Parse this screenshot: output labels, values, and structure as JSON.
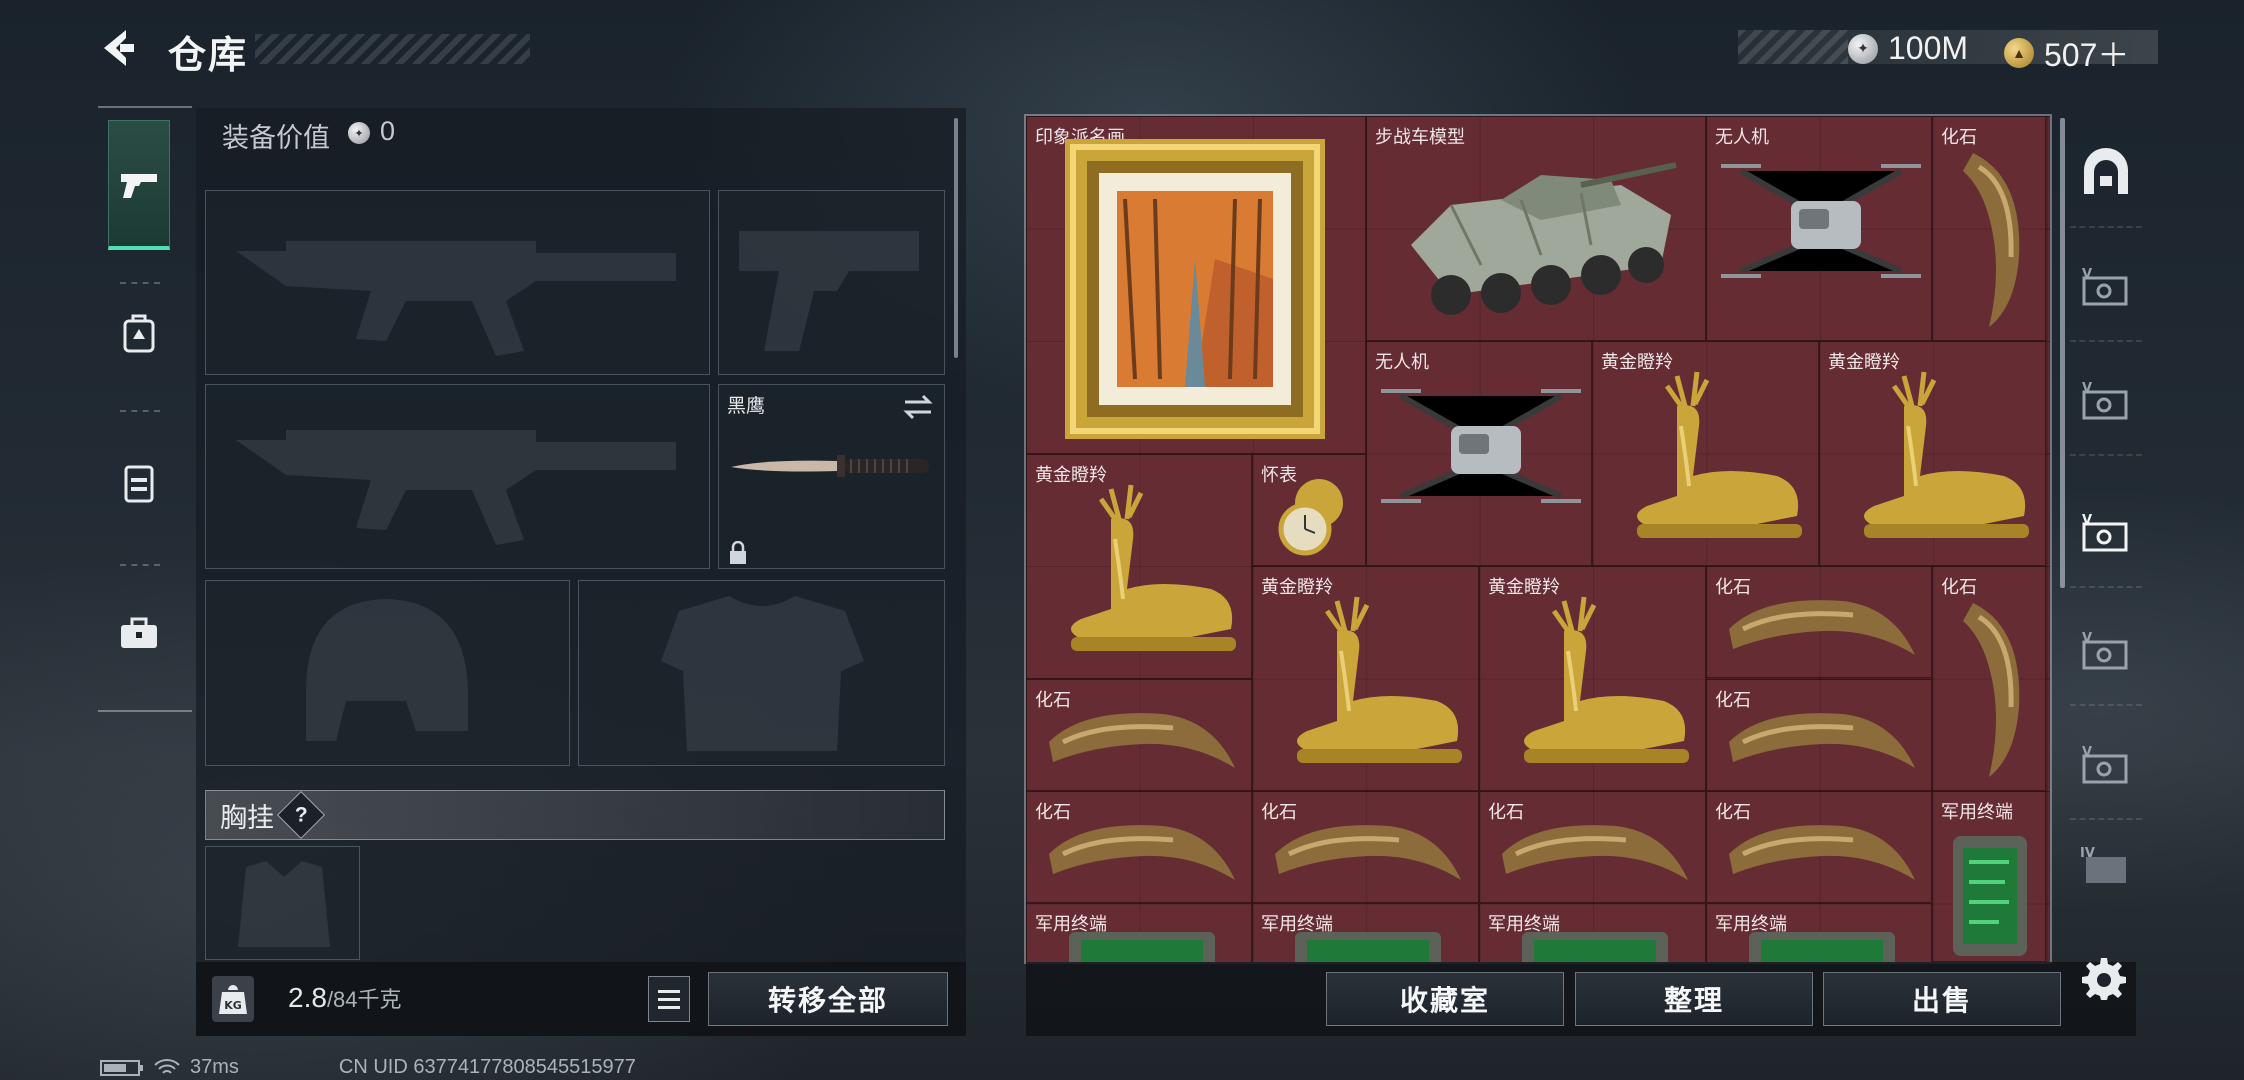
{
  "header": {
    "title": "仓库"
  },
  "currency": [
    {
      "icon": "silver-coin-icon",
      "value": "100M"
    },
    {
      "icon": "gold-coin-icon",
      "value": "507＋"
    }
  ],
  "equipment": {
    "value_label": "装备价值",
    "value": "0",
    "melee_name": "黑鹰",
    "chest_label": "胸挂",
    "help": "?"
  },
  "capacity": {
    "current": "2.8",
    "max": "/84千克"
  },
  "buttons": {
    "transfer_all": "转移全部",
    "collection": "收藏室",
    "organize": "整理",
    "sell": "出售"
  },
  "warehouse_items": [
    {
      "name": "印象派名画",
      "icon": "painting-icon"
    },
    {
      "name": "步战车模型",
      "icon": "ifv-model-icon"
    },
    {
      "name": "无人机",
      "icon": "drone-icon"
    },
    {
      "name": "化石",
      "icon": "fossil-claw-icon"
    },
    {
      "name": "无人机",
      "icon": "drone-icon"
    },
    {
      "name": "黄金瞪羚",
      "icon": "golden-gazelle-icon"
    },
    {
      "name": "黄金瞪羚",
      "icon": "golden-gazelle-icon"
    },
    {
      "name": "黄金瞪羚",
      "icon": "golden-gazelle-icon"
    },
    {
      "name": "怀表",
      "icon": "pocket-watch-icon"
    },
    {
      "name": "黄金瞪羚",
      "icon": "golden-gazelle-icon"
    },
    {
      "name": "黄金瞪羚",
      "icon": "golden-gazelle-icon"
    },
    {
      "name": "化石",
      "icon": "fossil-claw-icon"
    },
    {
      "name": "化石",
      "icon": "fossil-claw-icon"
    },
    {
      "name": "化石",
      "icon": "fossil-claw-icon"
    },
    {
      "name": "化石",
      "icon": "fossil-claw-icon"
    },
    {
      "name": "化石",
      "icon": "fossil-claw-icon"
    },
    {
      "name": "化石",
      "icon": "fossil-claw-icon"
    },
    {
      "name": "化石",
      "icon": "fossil-claw-icon"
    },
    {
      "name": "化石",
      "icon": "fossil-claw-icon"
    },
    {
      "name": "军用终端",
      "icon": "military-terminal-icon"
    },
    {
      "name": "军用终端",
      "icon": "military-terminal-icon"
    },
    {
      "name": "军用终端",
      "icon": "military-terminal-icon"
    },
    {
      "name": "军用终端",
      "icon": "military-terminal-icon"
    },
    {
      "name": "军用终端",
      "icon": "military-terminal-icon"
    }
  ],
  "status": {
    "ping": "37ms",
    "uid": "CN UID 63774177808545515977"
  },
  "colors": {
    "accent": "#4fe0b5",
    "grid_bg": "#5b2a31",
    "gold": "#c9a53a"
  }
}
